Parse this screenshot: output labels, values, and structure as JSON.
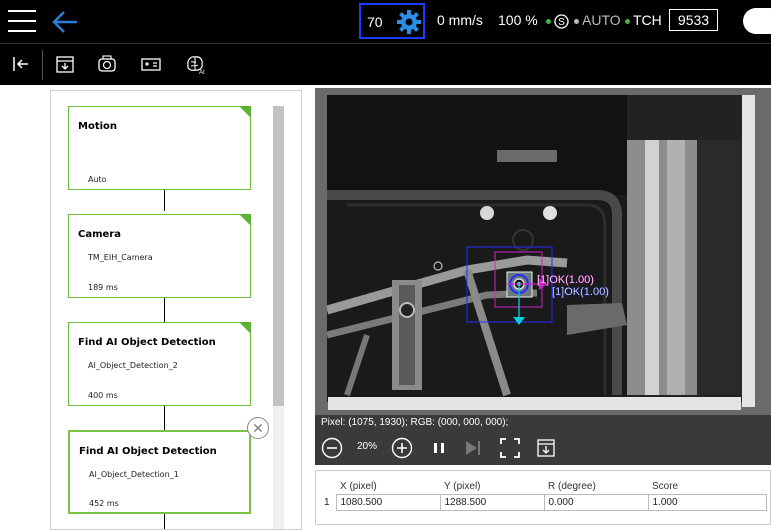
{
  "topbar": {
    "speed_value": "70",
    "velocity": "0 mm/s",
    "percent": "100 %",
    "mode_symbol": "S",
    "auto_label": "AUTO",
    "tch_label": "TCH",
    "id_value": "9533",
    "colors": {
      "dot": "#4caf50",
      "accent": "#2a7fd4",
      "speed_border": "#1a3cff"
    }
  },
  "toolbar": {
    "icons": [
      "exit-icon",
      "save-flow-icon",
      "camera-icon",
      "vision-job-icon",
      "ai-brain-icon"
    ]
  },
  "flow": {
    "nodes": [
      {
        "title": "Motion",
        "line1": "",
        "line2": "Auto"
      },
      {
        "title": "Camera",
        "line1": "TM_EIH_Camera",
        "line2": "189 ms"
      },
      {
        "title": "Find AI Object Detection",
        "line1": "AI_Object_Detection_2",
        "line2": "400 ms"
      },
      {
        "title": "Find AI Object Detection",
        "line1": "AI_Object_Detection_1",
        "line2": "452 ms"
      }
    ],
    "colors": {
      "node_border": "#7cc242"
    }
  },
  "viewer": {
    "overlay_labels": [
      "[1]OK(1.00)",
      "[1]OK(1.00)"
    ],
    "pixel_info": "Pixel: (1075, 1930); RGB: (000, 000, 000);",
    "zoom": "20%"
  },
  "results": {
    "headers": [
      "X (pixel)",
      "Y (pixel)",
      "R (degree)",
      "Score"
    ],
    "rows": [
      {
        "index": "1",
        "x": "1080.500",
        "y": "1288.500",
        "r": "0.000",
        "score": "1.000"
      }
    ]
  }
}
